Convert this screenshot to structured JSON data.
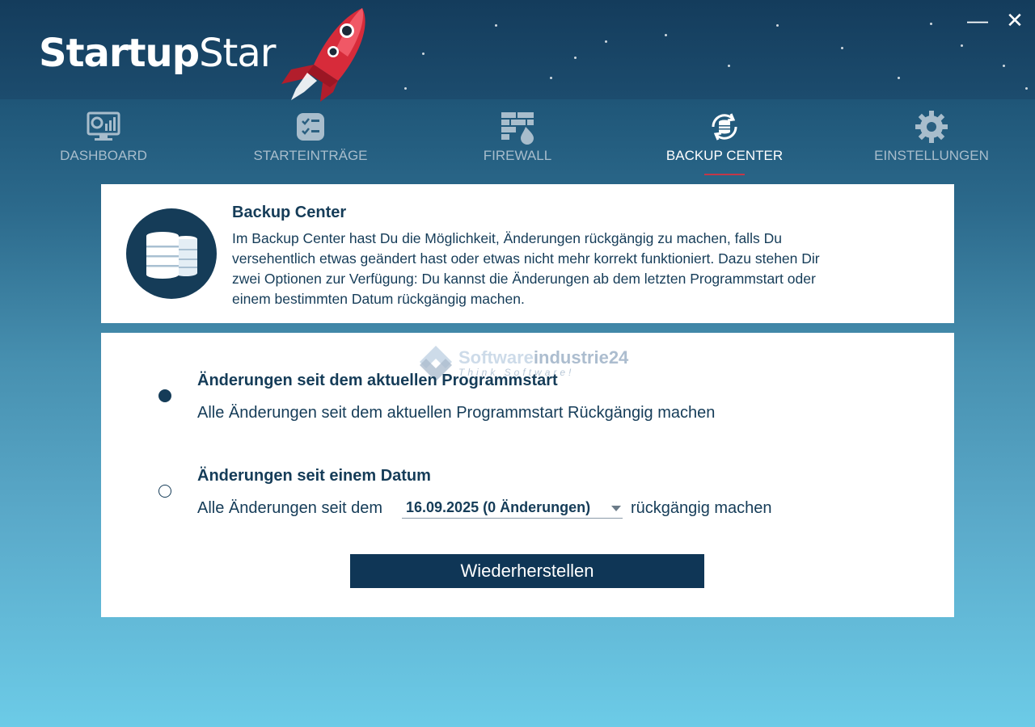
{
  "app": {
    "title_bold": "Startup",
    "title_light": "Star",
    "logo_icon": "rocket-icon"
  },
  "window_controls": {
    "minimize": "—",
    "close": "✕"
  },
  "nav": {
    "items": [
      {
        "label": "DASHBOARD",
        "icon": "dashboard-icon",
        "active": false
      },
      {
        "label": "STARTEINTRÄGE",
        "icon": "checklist-icon",
        "active": false
      },
      {
        "label": "FIREWALL",
        "icon": "firewall-icon",
        "active": false
      },
      {
        "label": "BACKUP CENTER",
        "icon": "backup-icon",
        "active": true
      },
      {
        "label": "EINSTELLUNGEN",
        "icon": "gear-icon",
        "active": false
      }
    ]
  },
  "info": {
    "title": "Backup Center",
    "description": "Im Backup Center hast Du die Möglichkeit, Änderungen rückgängig zu machen, falls Du versehentlich etwas geändert hast oder etwas nicht mehr korrekt funktioniert. Dazu stehen Dir zwei Optionen zur Verfügung: Du kannst die Änderungen ab dem letzten Programmstart oder einem bestimmten Datum rückgängig machen.",
    "icon": "database-icon"
  },
  "options": {
    "option1": {
      "title": "Änderungen seit dem aktuellen Programmstart",
      "description": "Alle Änderungen seit dem aktuellen Programmstart Rückgängig machen",
      "selected": true
    },
    "option2": {
      "title": "Änderungen seit einem Datum",
      "prefix": "Alle Änderungen seit dem",
      "date_value": "16.09.2025 (0 Änderungen)",
      "suffix": "rückgängig machen",
      "selected": false
    }
  },
  "restore_button": "Wiederherstellen",
  "watermark": {
    "line1_pre": "Software",
    "line1_post": "industrie24",
    "line2": "Think Software!"
  },
  "colors": {
    "primary": "#153c58",
    "button": "#0f3656",
    "accent_underline": "#c43848",
    "nav_inactive": "#a8bdcc"
  }
}
